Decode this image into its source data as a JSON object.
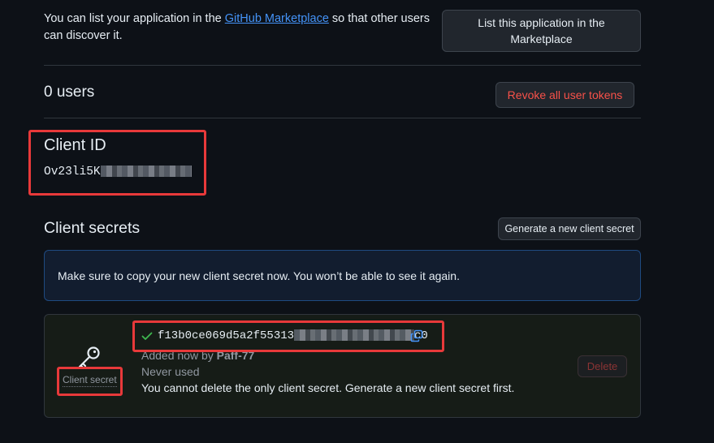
{
  "marketplace": {
    "text_before": "You can list your application in the ",
    "link": "GitHub Marketplace",
    "text_after": " so that other users can discover it.",
    "button": "List this application in the Marketplace"
  },
  "users": {
    "title": "0 users",
    "revoke_button": "Revoke all user tokens"
  },
  "client_id": {
    "title": "Client ID",
    "value_visible": "Ov23li5K"
  },
  "client_secrets": {
    "title": "Client secrets",
    "generate_button": "Generate a new client secret",
    "notice": "Make sure to copy your new client secret now. You won’t be able to see it again.",
    "secret": {
      "label": "Client secret",
      "value_prefix": "f13b0ce069d5a2f55313",
      "value_suffix": "c0",
      "added_text": "Added now by",
      "added_by": "Paff-77",
      "usage": "Never used",
      "warning": "You cannot delete the only client secret. Generate a new client secret first.",
      "delete_button": "Delete"
    }
  },
  "colors": {
    "background": "#0d1117",
    "link": "#4493f8",
    "danger": "#f85149",
    "success": "#3fb950",
    "highlight": "#e8393a"
  },
  "icons": [
    "key-icon",
    "check-icon",
    "copy-icon"
  ]
}
